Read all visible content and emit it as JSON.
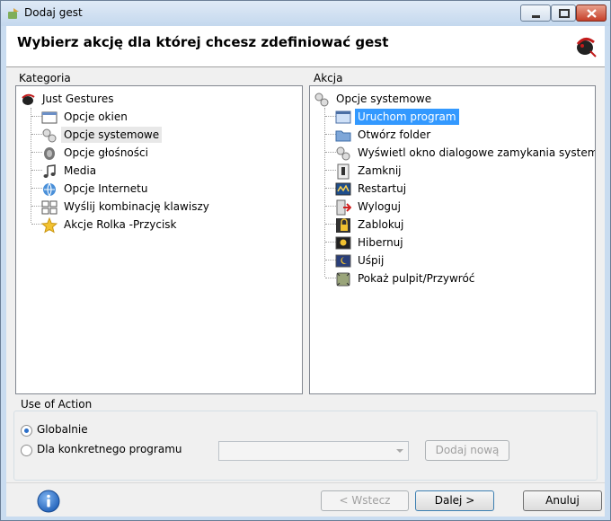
{
  "window": {
    "title": "Dodaj gest"
  },
  "header": {
    "title": "Wybierz akcję dla której chcesz zdefiniować gest"
  },
  "kategoria": {
    "label": "Kategoria",
    "root": "Just Gestures",
    "items": [
      "Opcje okien",
      "Opcje systemowe",
      "Opcje głośności",
      "Media",
      "Opcje Internetu",
      "Wyślij kombinację klawiszy",
      "Akcje Rolka -Przycisk"
    ],
    "selected": "Opcje systemowe"
  },
  "akcja": {
    "label": "Akcja",
    "root": "Opcje systemowe",
    "items": [
      "Uruchom program",
      "Otwórz folder",
      "Wyświetl okno dialogowe zamykania systemu",
      "Zamknij",
      "Restartuj",
      "Wyloguj",
      "Zablokuj",
      "Hibernuj",
      "Uśpij",
      "Pokaż pulpit/Przywróć"
    ],
    "selected": "Uruchom program"
  },
  "use_of_action": {
    "label": "Use of Action",
    "option_global": "Globalnie",
    "option_program": "Dla konkretnego programu",
    "selected": "global",
    "program_value": "",
    "add_new": "Dodaj nową"
  },
  "buttons": {
    "back": "< Wstecz",
    "next": "Dalej >",
    "cancel": "Anuluj"
  },
  "colors": {
    "selection": "#3399ff",
    "accent": "#2b6fc9"
  }
}
